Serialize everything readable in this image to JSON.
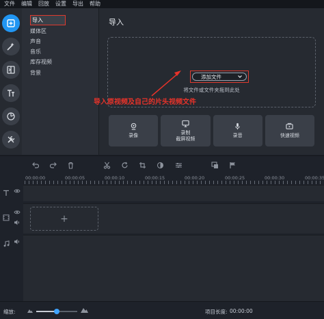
{
  "menu": [
    "文件",
    "编辑",
    "回放",
    "设置",
    "导出",
    "帮助"
  ],
  "rail": [
    "import-icon",
    "magic-wand-icon",
    "transition-icon",
    "title-text-icon",
    "sticker-icon",
    "tools-icon"
  ],
  "categories": [
    "导入",
    "媒体区",
    "声音",
    "音乐",
    "库存视频",
    "背景"
  ],
  "import_panel": {
    "title": "导入",
    "add_button": "添加文件",
    "drop_hint": "将文件或文件夹拖到此处",
    "tiles": [
      {
        "icon": "webcam-icon",
        "label": "录像"
      },
      {
        "icon": "screen-record-icon",
        "label": "录制\n截屏视频"
      },
      {
        "icon": "microphone-icon",
        "label": "录音"
      },
      {
        "icon": "quick-video-icon",
        "label": "快速视频"
      }
    ]
  },
  "annotation": "导入原视频及自己的片头视频文件",
  "timeline": {
    "ruler": [
      "00:00:00",
      "00:00:05",
      "00:00:10",
      "00:00:15",
      "00:00:20",
      "00:00:25",
      "00:00:30",
      "00:00:35",
      "00:00:40",
      "00:00:45"
    ],
    "add_clip": "+"
  },
  "status": {
    "zoom_label": "缩放:",
    "zoom_value": 0.5,
    "length_label": "项目长度:",
    "length_value": "00:00:00"
  },
  "colors": {
    "accent": "#2196f3",
    "annotation": "#e8332a"
  }
}
